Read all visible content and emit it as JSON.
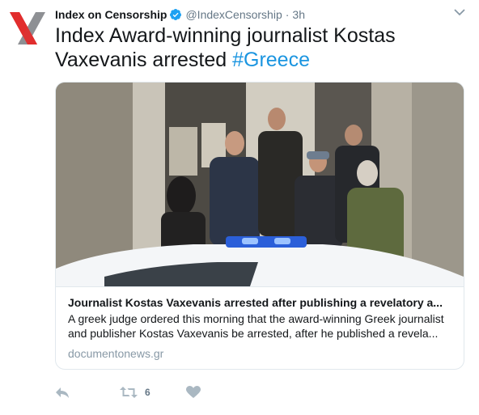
{
  "colors": {
    "accent": "#1b95e0",
    "verified": "#1da1f2",
    "secondary_text": "#657786",
    "card_border": "#e1e8ed",
    "logo_red": "#e02d2d",
    "logo_gray": "#8e9094"
  },
  "author": {
    "name": "Index on Censorship",
    "handle": "@IndexCensorship",
    "separator": "·",
    "time": "3h",
    "avatar_icon": "index-logo-icon",
    "verified_icon": "verified-badge-icon"
  },
  "tweet": {
    "text": "Index Award-winning journalist Kostas Vaxevanis arrested ",
    "hashtag": "#Greece"
  },
  "card": {
    "image_description_icon": "photo-image",
    "title": "Journalist Kostas Vaxevanis arrested after publishing a revelatory a...",
    "description": "A greek judge ordered this morning that the award-winning Greek journalist and publisher Kostas Vaxevanis be arrested, after he published a revela...",
    "domain": "documentonews.gr"
  },
  "actions": {
    "reply_icon": "reply-icon",
    "retweet_icon": "retweet-icon",
    "retweet_count": "6",
    "like_icon": "heart-icon",
    "more_icon": "chevron-down-icon"
  }
}
